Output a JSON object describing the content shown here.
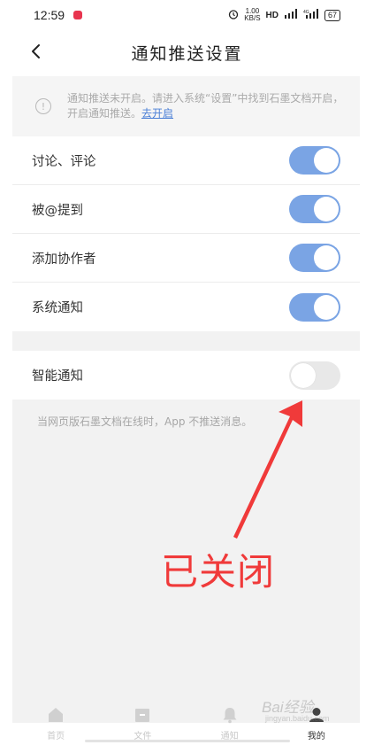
{
  "status_bar": {
    "time": "12:59",
    "speed": "1.00",
    "speed_unit": "KB/S",
    "hd": "HD",
    "network": "4G",
    "battery": "67"
  },
  "header": {
    "title": "通知推送设置"
  },
  "notice": {
    "text": "通知推送未开启。请进入系统“设置”中找到石墨文档开启，开启通知推送。",
    "link": "去开启"
  },
  "settings": [
    {
      "label": "讨论、评论",
      "enabled": true
    },
    {
      "label": "被@提到",
      "enabled": true
    },
    {
      "label": "添加协作者",
      "enabled": true
    },
    {
      "label": "系统通知",
      "enabled": true
    }
  ],
  "smart_notification": {
    "label": "智能通知",
    "enabled": false,
    "hint": "当网页版石墨文档在线时，App 不推送消息。"
  },
  "annotation": {
    "text": "已关闭",
    "color": "#f03a3a"
  },
  "tabs": [
    {
      "label": "首页",
      "icon": "home-icon"
    },
    {
      "label": "文件",
      "icon": "folder-icon"
    },
    {
      "label": "通知",
      "icon": "bell-icon"
    },
    {
      "label": "我的",
      "icon": "user-icon",
      "active": true
    }
  ],
  "watermark": {
    "text": "Bai经验",
    "sub": "jingyan.baidu.com"
  },
  "colors": {
    "toggle_on": "#7aa4e4",
    "toggle_off": "#e8e8e8",
    "link": "#4a7fd6",
    "background": "#f2f2f2"
  }
}
